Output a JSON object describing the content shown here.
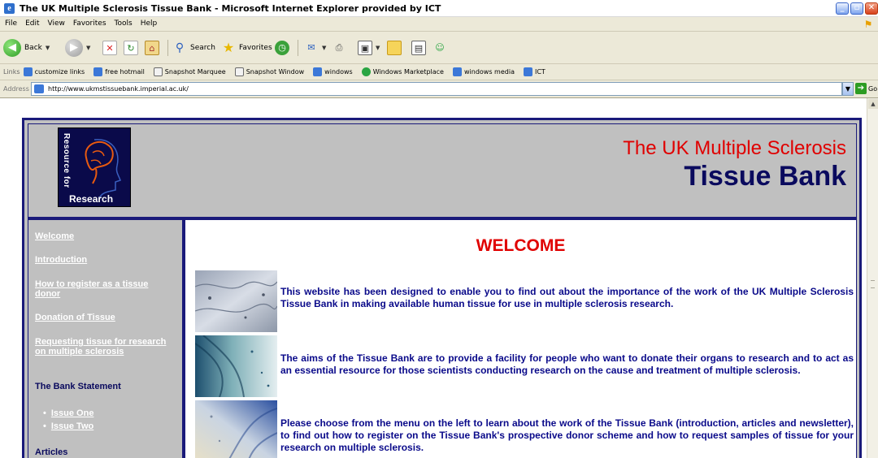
{
  "window": {
    "title": "The UK Multiple Sclerosis Tissue Bank - Microsoft Internet Explorer provided by ICT"
  },
  "menu": [
    "File",
    "Edit",
    "View",
    "Favorites",
    "Tools",
    "Help"
  ],
  "toolbar": {
    "back": "Back",
    "search": "Search",
    "favorites": "Favorites"
  },
  "links_bar": {
    "label": "Links",
    "items": [
      "customize links",
      "free hotmail",
      "Snapshot Marquee",
      "Snapshot Window",
      "windows",
      "Windows Marketplace",
      "windows media",
      "ICT"
    ]
  },
  "address": {
    "label": "Address",
    "url": "http://www.ukmstissuebank.imperial.ac.uk/",
    "go": "Go"
  },
  "site": {
    "logo_side": "Resource for",
    "logo_bottom": "Research",
    "title_line1": "The UK Multiple Sclerosis",
    "title_line2": "Tissue Bank"
  },
  "nav": {
    "welcome": "Welcome",
    "introduction": "Introduction",
    "register": "How to register as a tissue donor",
    "donation": "Donation of Tissue",
    "requesting": "Requesting tissue for research on multiple sclerosis",
    "bank_statement": "The Bank Statement",
    "issue_one": "Issue One",
    "issue_two": "Issue Two",
    "articles": "Articles"
  },
  "main": {
    "heading": "WELCOME",
    "para1": "This website has been designed to enable you to find out about the importance of the work of the UK Multiple Sclerosis Tissue Bank in making available human tissue for use in multiple sclerosis research.",
    "para2": "The aims of the Tissue Bank are to provide a facility for people who want to donate their organs to research and to act as an essential resource for those scientists conducting research on the cause and treatment of multiple sclerosis.",
    "para3": "Please choose from the menu on the left to learn about the work of the Tissue Bank (introduction, articles and newsletter), to find out how to register on the Tissue Bank's prospective donor scheme and how to request samples of tissue for your research on multiple sclerosis."
  },
  "colors": {
    "frame": "#1a1a7a",
    "title_red": "#e00000",
    "title_blue": "#0a0a5e",
    "body_text": "#0a0a8a",
    "sidebar_bg": "#c0c0c0"
  }
}
